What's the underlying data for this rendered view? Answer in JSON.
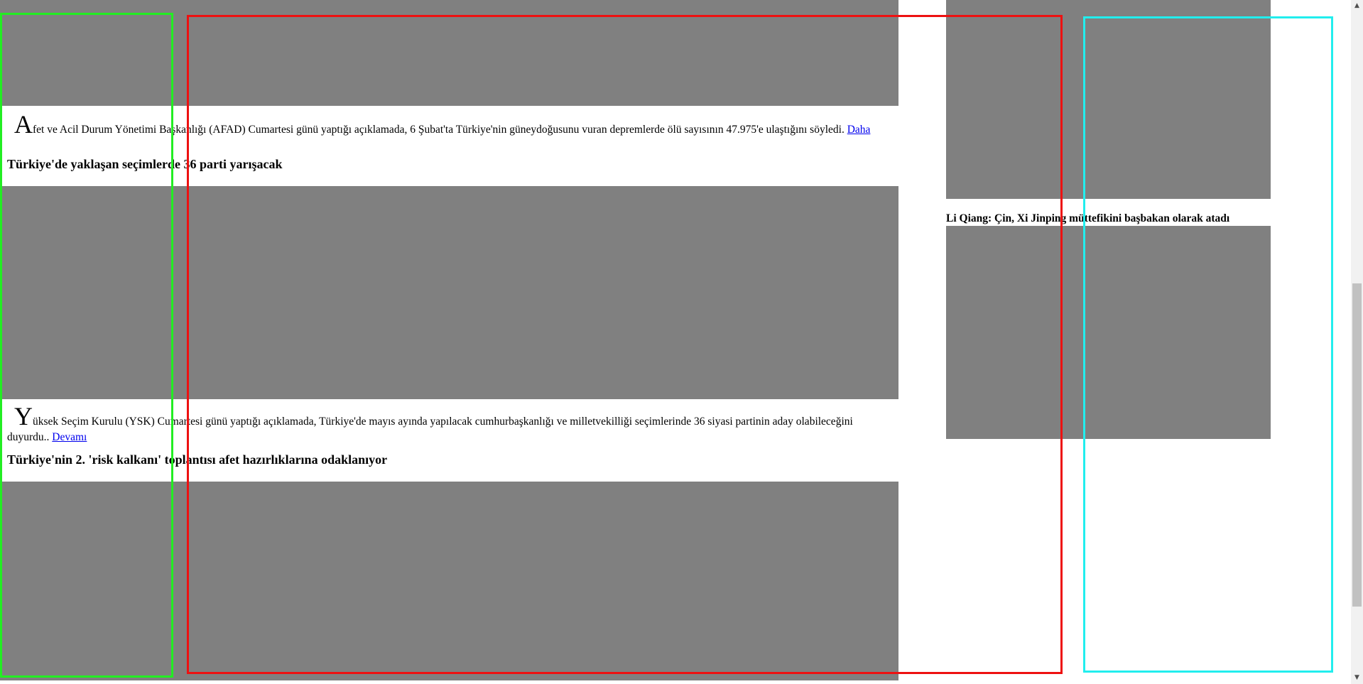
{
  "articles": [
    {
      "dropcap": "A",
      "body": "fet ve Acil Durum Yönetimi Başkanlığı (AFAD) Cumartesi günü yaptığı açıklamada, 6 Şubat'ta Türkiye'nin güneydoğusunu vuran depremlerde ölü sayısının 47.975'e ulaştığını söyledi. ",
      "more_link": "Daha"
    },
    {
      "headline": "Türkiye'de yaklaşan seçimlerde 36 parti yarışacak",
      "dropcap": "Y",
      "body": "üksek Seçim Kurulu (YSK) Cumartesi günü yaptığı açıklamada, Türkiye'de mayıs ayında yapılacak cumhurbaşkanlığı ve milletvekilliği seçimlerinde 36 siyasi partinin aday olabileceğini duyurdu.. ",
      "more_link": "Devamı"
    },
    {
      "headline": "Türkiye'nin 2. 'risk kalkanı' toplantısı afet hazırlıklarına odaklanıyor"
    }
  ],
  "sidebar": {
    "headline": "Li Qiang: Çin, Xi Jinping müttefikini başbakan olarak atadı"
  },
  "overlay_colors": {
    "green": "#22ee22",
    "red": "#ee1111",
    "cyan": "#22eeee"
  },
  "placeholder_color": "#808080",
  "scrollbar": {
    "up_icon": "triangle-up",
    "down_icon": "triangle-down"
  }
}
